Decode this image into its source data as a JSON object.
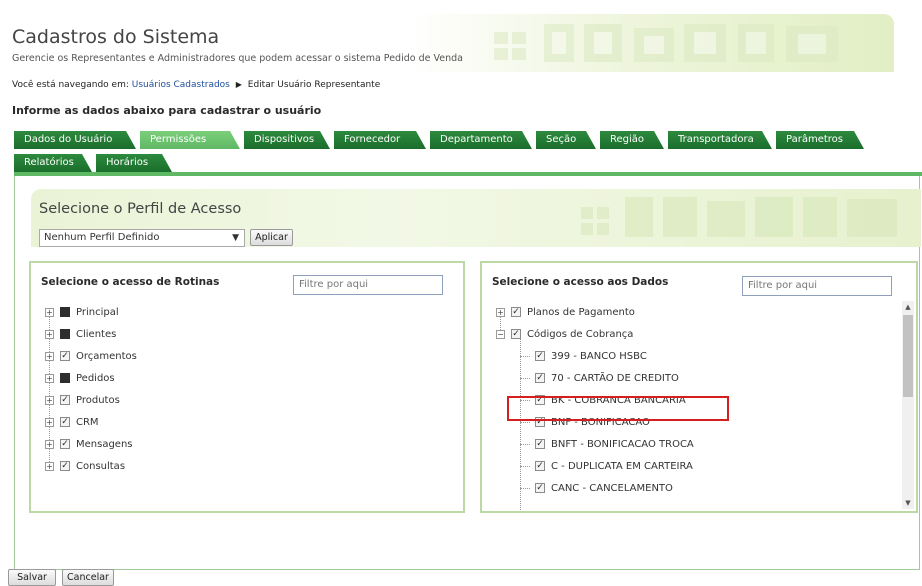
{
  "header": {
    "title": "Cadastros do Sistema",
    "subtitle": "Gerencie os Representantes e Administradores que podem acessar o sistema Pedido de Venda"
  },
  "breadcrumb": {
    "prefix": "Você está navegando em:",
    "link": "Usuários Cadastrados",
    "current": "Editar Usuário Representante"
  },
  "instruction": "Informe as dados abaixo para cadastrar o usuário",
  "tabs_row1": [
    "Dados do Usuário",
    "Permissões",
    "Dispositivos",
    "Fornecedor",
    "Departamento",
    "Seção",
    "Região",
    "Transportadora",
    "Parâmetros"
  ],
  "tabs_row2": [
    "Relatórios",
    "Horários"
  ],
  "active_tab": "Permissões",
  "perfil": {
    "title": "Selecione o Perfil de Acesso",
    "selected": "Nenhum Perfil Definido",
    "apply_label": "Aplicar"
  },
  "rotinas": {
    "title": "Selecione o acesso de Rotinas",
    "filter_placeholder": "Filtre por aqui",
    "items": [
      {
        "label": "Principal",
        "state": "partial"
      },
      {
        "label": "Clientes",
        "state": "partial"
      },
      {
        "label": "Orçamentos",
        "state": "checked"
      },
      {
        "label": "Pedidos",
        "state": "partial"
      },
      {
        "label": "Produtos",
        "state": "checked"
      },
      {
        "label": "CRM",
        "state": "checked"
      },
      {
        "label": "Mensagens",
        "state": "checked"
      },
      {
        "label": "Consultas",
        "state": "checked"
      }
    ]
  },
  "dados": {
    "title": "Selecione o acesso aos Dados",
    "filter_placeholder": "Filtre por aqui",
    "items": [
      {
        "label": "Planos de Pagamento",
        "level": 0,
        "expander": "+"
      },
      {
        "label": "Códigos de Cobrança",
        "level": 0,
        "expander": "-"
      },
      {
        "label": "399 - BANCO HSBC",
        "level": 1
      },
      {
        "label": "70 - CARTÃO DE CREDITO",
        "level": 1
      },
      {
        "label": "BK - COBRANCA BANCARIA",
        "level": 1
      },
      {
        "label": "BNF - BONIFICACAO",
        "level": 1
      },
      {
        "label": "BNFT - BONIFICACAO TROCA",
        "level": 1
      },
      {
        "label": "C - DUPLICATA EM CARTEIRA",
        "level": 1
      },
      {
        "label": "CANC - CANCELAMENTO",
        "level": 1
      }
    ]
  },
  "footer": {
    "save_label": "Salvar",
    "cancel_label": "Cancelar"
  }
}
